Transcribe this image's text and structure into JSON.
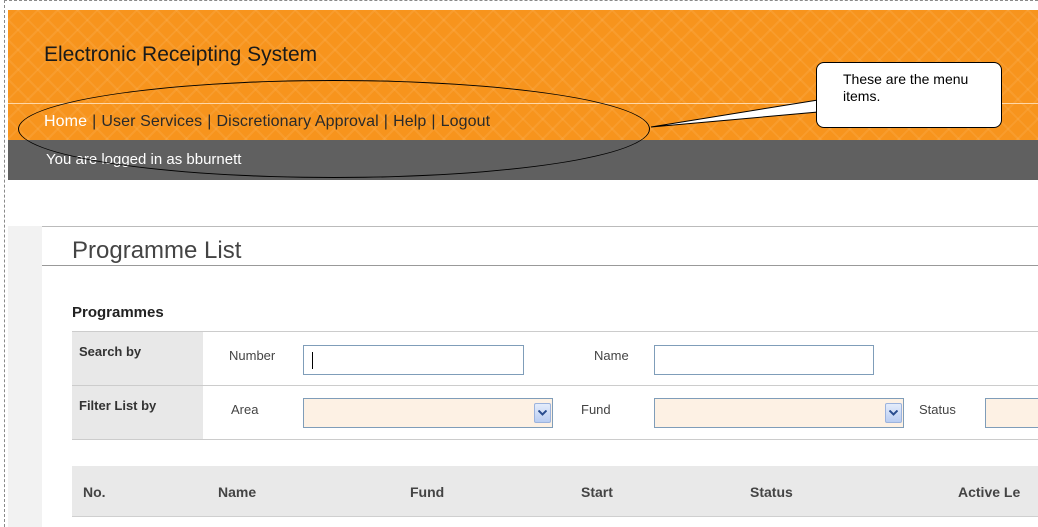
{
  "app": {
    "title": "Electronic Receipting System"
  },
  "menu": {
    "items": [
      {
        "label": "Home",
        "active": true
      },
      {
        "label": "User Services",
        "active": false
      },
      {
        "label": "Discretionary Approval",
        "active": false
      },
      {
        "label": "Help",
        "active": false
      },
      {
        "label": "Logout",
        "active": false
      }
    ],
    "separator": "|"
  },
  "status": {
    "logged_in_text": "You are logged in as bburnett"
  },
  "annotation": {
    "callout_text": "These are the menu items."
  },
  "page": {
    "title": "Programme List",
    "section": "Programmes"
  },
  "search": {
    "label": "Search by",
    "number_label": "Number",
    "number_value": "",
    "name_label": "Name",
    "name_value": ""
  },
  "filter": {
    "label": "Filter List by",
    "area_label": "Area",
    "area_value": "",
    "fund_label": "Fund",
    "fund_value": "",
    "status_label": "Status",
    "status_value": ""
  },
  "list": {
    "columns": [
      "No.",
      "Name",
      "Fund",
      "Start",
      "Status",
      "Active Le"
    ]
  },
  "colors": {
    "header_orange": "#f7941d",
    "status_bar_grey": "#606060",
    "active_menu_text": "#ffffff",
    "select_background": "#fdf1e4"
  }
}
